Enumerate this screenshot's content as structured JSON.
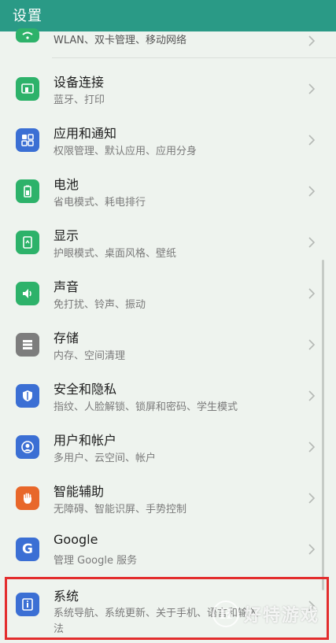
{
  "header": {
    "title": "设置"
  },
  "settings": [
    {
      "key": "wlan",
      "icon": "wifi-icon",
      "color": "#2db26a",
      "title": "",
      "subtitle": "WLAN、双卡管理、移动网络"
    },
    {
      "key": "device-connection",
      "icon": "device-connection-icon",
      "color": "#2db26a",
      "title": "设备连接",
      "subtitle": "蓝牙、打印"
    },
    {
      "key": "apps-notifications",
      "icon": "apps-grid-icon",
      "color": "#3b6fd4",
      "title": "应用和通知",
      "subtitle": "权限管理、默认应用、应用分身"
    },
    {
      "key": "battery",
      "icon": "battery-icon",
      "color": "#2db26a",
      "title": "电池",
      "subtitle": "省电模式、耗电排行"
    },
    {
      "key": "display",
      "icon": "display-icon",
      "color": "#2db26a",
      "title": "显示",
      "subtitle": "护眼模式、桌面风格、壁纸"
    },
    {
      "key": "sound",
      "icon": "speaker-icon",
      "color": "#2db26a",
      "title": "声音",
      "subtitle": "免打扰、铃声、振动"
    },
    {
      "key": "storage",
      "icon": "storage-icon",
      "color": "#7d7d7d",
      "title": "存储",
      "subtitle": "内存、空间清理"
    },
    {
      "key": "security-privacy",
      "icon": "shield-icon",
      "color": "#3b6fd4",
      "title": "安全和隐私",
      "subtitle": "指纹、人脸解锁、锁屏和密码、学生模式"
    },
    {
      "key": "users-accounts",
      "icon": "user-icon",
      "color": "#3b6fd4",
      "title": "用户和帐户",
      "subtitle": "多用户、云空间、帐户"
    },
    {
      "key": "smart-assist",
      "icon": "hand-icon",
      "color": "#e8672a",
      "title": "智能辅助",
      "subtitle": "无障碍、智能识屏、手势控制"
    },
    {
      "key": "google",
      "icon": "google-icon",
      "color": "#3b6fd4",
      "title": "Google",
      "subtitle": "管理 Google 服务"
    },
    {
      "key": "system",
      "icon": "system-info-icon",
      "color": "#3b6fd4",
      "title": "系统",
      "subtitle": "系统导航、系统更新、关于手机、语言和输入",
      "subtitle2": "法"
    }
  ],
  "watermark": {
    "logo": "H",
    "text": "好特游戏"
  }
}
